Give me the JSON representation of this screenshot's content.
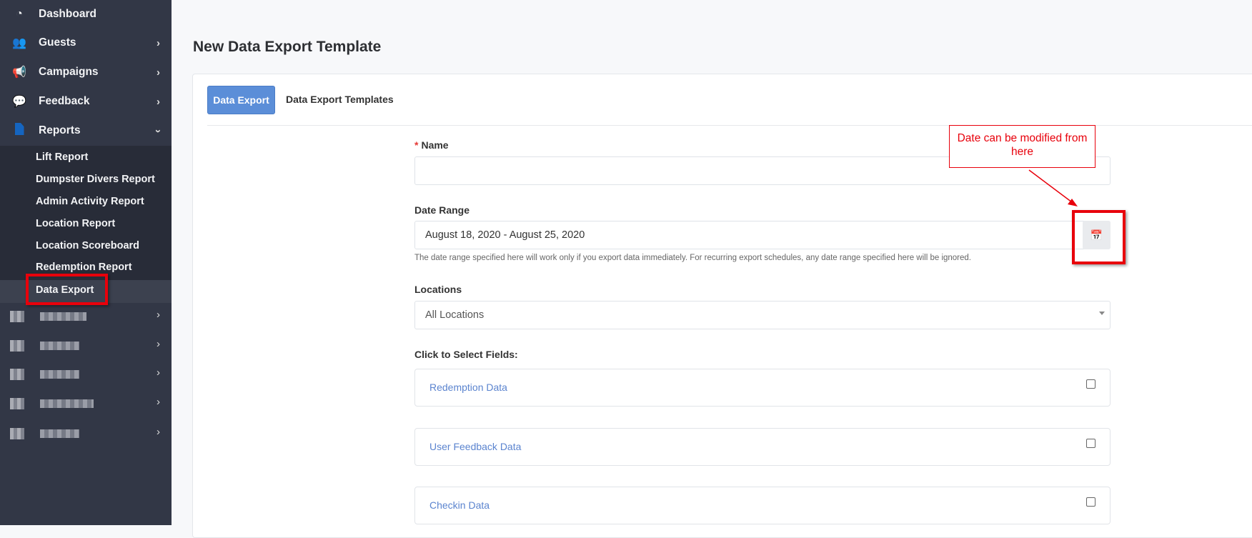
{
  "sidebar": {
    "items": [
      {
        "label": "Dashboard",
        "icon": "dashboard-icon",
        "chevron": false
      },
      {
        "label": "Guests",
        "icon": "users-icon",
        "chevron": true
      },
      {
        "label": "Campaigns",
        "icon": "megaphone-icon",
        "chevron": true
      },
      {
        "label": "Feedback",
        "icon": "comment-icon",
        "chevron": true
      },
      {
        "label": "Reports",
        "icon": "file-icon",
        "chevron": "down",
        "icon_color": "#1565c0"
      }
    ],
    "reports_submenu": [
      "Lift Report",
      "Dumpster Divers Report",
      "Admin Activity Report",
      "Location Report",
      "Location Scoreboard",
      "Redemption Report",
      "Data Export"
    ],
    "active_item": "Data Export",
    "blurred_items_count": 5
  },
  "page": {
    "title": "New Data Export Template",
    "tabs": [
      {
        "label": "Data Export",
        "active": true
      },
      {
        "label": "Data Export Templates",
        "active": false
      }
    ]
  },
  "form": {
    "name": {
      "label": "Name",
      "required_mark": "*",
      "value": ""
    },
    "date_range": {
      "label": "Date Range",
      "value": "August 18, 2020 - August 25, 2020",
      "help": "The date range specified here will work only if you export data immediately. For recurring export schedules, any date range specified here will be ignored."
    },
    "locations": {
      "label": "Locations",
      "value": "All Locations"
    },
    "fields_label": "Click to Select Fields:",
    "fields": [
      {
        "label": "Redemption Data",
        "checked": false
      },
      {
        "label": "User Feedback Data",
        "checked": false
      },
      {
        "label": "Checkin Data",
        "checked": false
      }
    ]
  },
  "annotation": {
    "text": "Date can be modified from here",
    "color": "#e8000b"
  },
  "colors": {
    "sidebar_bg": "#323746",
    "primary": "#5b8ed8",
    "link": "#5b84cf"
  }
}
